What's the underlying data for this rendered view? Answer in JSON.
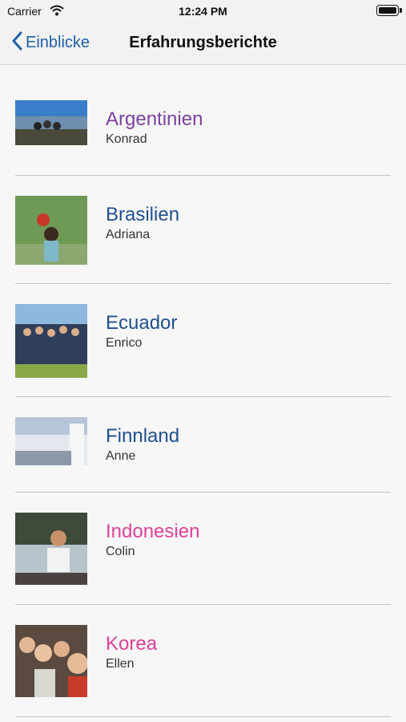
{
  "status": {
    "carrier": "Carrier",
    "time": "12:24 PM"
  },
  "nav": {
    "back_label": "Einblicke",
    "title": "Erfahrungsberichte"
  },
  "entries": [
    {
      "country": "Argentinien",
      "person": "Konrad",
      "color": "#7b3fa0"
    },
    {
      "country": "Brasilien",
      "person": "Adriana",
      "color": "#1f4f8f"
    },
    {
      "country": "Ecuador",
      "person": "Enrico",
      "color": "#1f4f8f"
    },
    {
      "country": "Finnland",
      "person": "Anne",
      "color": "#1f4f8f"
    },
    {
      "country": "Indonesien",
      "person": "Colin",
      "color": "#e0409a"
    },
    {
      "country": "Korea",
      "person": "Ellen",
      "color": "#e0409a"
    }
  ]
}
